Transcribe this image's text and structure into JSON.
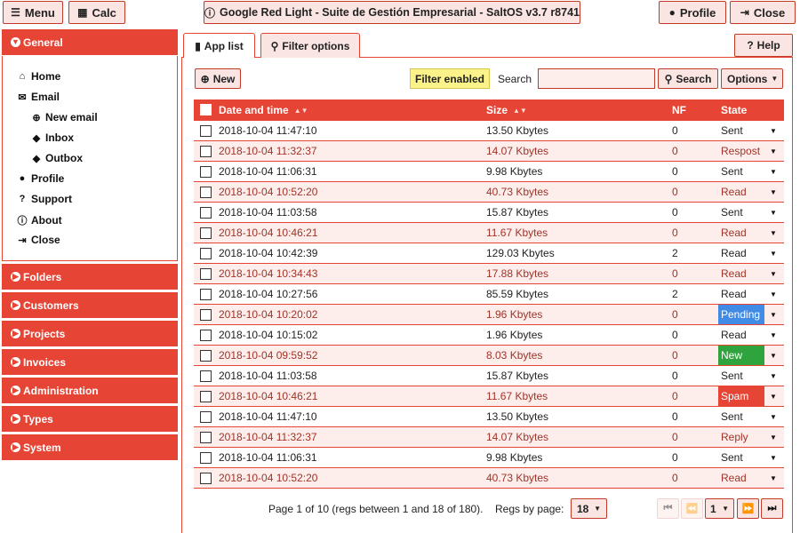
{
  "topbar": {
    "menu_label": "Menu",
    "calc_label": "Calc",
    "title": "Google Red Light - Suite de Gestión Empresarial - SaltOS v3.7 r8741",
    "profile_label": "Profile",
    "close_label": "Close"
  },
  "sidebar": {
    "general": "General",
    "items": [
      {
        "label": "Home",
        "icon": "home-icon"
      },
      {
        "label": "Email",
        "icon": "envelope-icon"
      },
      {
        "label": "New email",
        "icon": "plus-circle-icon"
      },
      {
        "label": "Inbox",
        "icon": "tag-icon"
      },
      {
        "label": "Outbox",
        "icon": "tag-icon"
      },
      {
        "label": "Profile",
        "icon": "user-icon"
      },
      {
        "label": "Support",
        "icon": "question-icon"
      },
      {
        "label": "About",
        "icon": "info-icon"
      },
      {
        "label": "Close",
        "icon": "sign-out-icon"
      }
    ],
    "sections": [
      "Folders",
      "Customers",
      "Projects",
      "Invoices",
      "Administration",
      "Types",
      "System"
    ]
  },
  "tabs": {
    "app_list": "App list",
    "filter_options": "Filter options",
    "help": "Help"
  },
  "toolbar": {
    "new_label": "New",
    "filter_badge": "Filter enabled",
    "search_label": "Search",
    "search_value": "",
    "search_button": "Search",
    "options_label": "Options"
  },
  "table": {
    "columns": [
      "Date and time",
      "Size",
      "NF",
      "State"
    ],
    "rows": [
      {
        "date": "2018-10-04 11:47:10",
        "size": "13.50 Kbytes",
        "nf": "0",
        "state": "Sent"
      },
      {
        "date": "2018-10-04 11:32:37",
        "size": "14.07 Kbytes",
        "nf": "0",
        "state": "Respost"
      },
      {
        "date": "2018-10-04 11:06:31",
        "size": "9.98 Kbytes",
        "nf": "0",
        "state": "Sent"
      },
      {
        "date": "2018-10-04 10:52:20",
        "size": "40.73 Kbytes",
        "nf": "0",
        "state": "Read"
      },
      {
        "date": "2018-10-04 11:03:58",
        "size": "15.87 Kbytes",
        "nf": "0",
        "state": "Sent"
      },
      {
        "date": "2018-10-04 10:46:21",
        "size": "11.67 Kbytes",
        "nf": "0",
        "state": "Read"
      },
      {
        "date": "2018-10-04 10:42:39",
        "size": "129.03 Kbytes",
        "nf": "2",
        "state": "Read"
      },
      {
        "date": "2018-10-04 10:34:43",
        "size": "17.88 Kbytes",
        "nf": "0",
        "state": "Read"
      },
      {
        "date": "2018-10-04 10:27:56",
        "size": "85.59 Kbytes",
        "nf": "2",
        "state": "Read"
      },
      {
        "date": "2018-10-04 10:20:02",
        "size": "1.96 Kbytes",
        "nf": "0",
        "state": "Pending"
      },
      {
        "date": "2018-10-04 10:15:02",
        "size": "1.96 Kbytes",
        "nf": "0",
        "state": "Read"
      },
      {
        "date": "2018-10-04 09:59:52",
        "size": "8.03 Kbytes",
        "nf": "0",
        "state": "New"
      },
      {
        "date": "2018-10-04 11:03:58",
        "size": "15.87 Kbytes",
        "nf": "0",
        "state": "Sent"
      },
      {
        "date": "2018-10-04 10:46:21",
        "size": "11.67 Kbytes",
        "nf": "0",
        "state": "Spam"
      },
      {
        "date": "2018-10-04 11:47:10",
        "size": "13.50 Kbytes",
        "nf": "0",
        "state": "Sent"
      },
      {
        "date": "2018-10-04 11:32:37",
        "size": "14.07 Kbytes",
        "nf": "0",
        "state": "Reply"
      },
      {
        "date": "2018-10-04 11:06:31",
        "size": "9.98 Kbytes",
        "nf": "0",
        "state": "Sent"
      },
      {
        "date": "2018-10-04 10:52:20",
        "size": "40.73 Kbytes",
        "nf": "0",
        "state": "Read"
      }
    ]
  },
  "pager": {
    "info": "Page 1 of 10 (regs between 1 and 18 of 180).",
    "regs_label": "Regs by page:",
    "regs_value": "18",
    "page_value": "1"
  },
  "colors": {
    "accent": "#e64435",
    "pending": "#3f8be6",
    "new": "#2fa33d",
    "spam": "#e64435",
    "filter_badge": "#fbf28a"
  }
}
